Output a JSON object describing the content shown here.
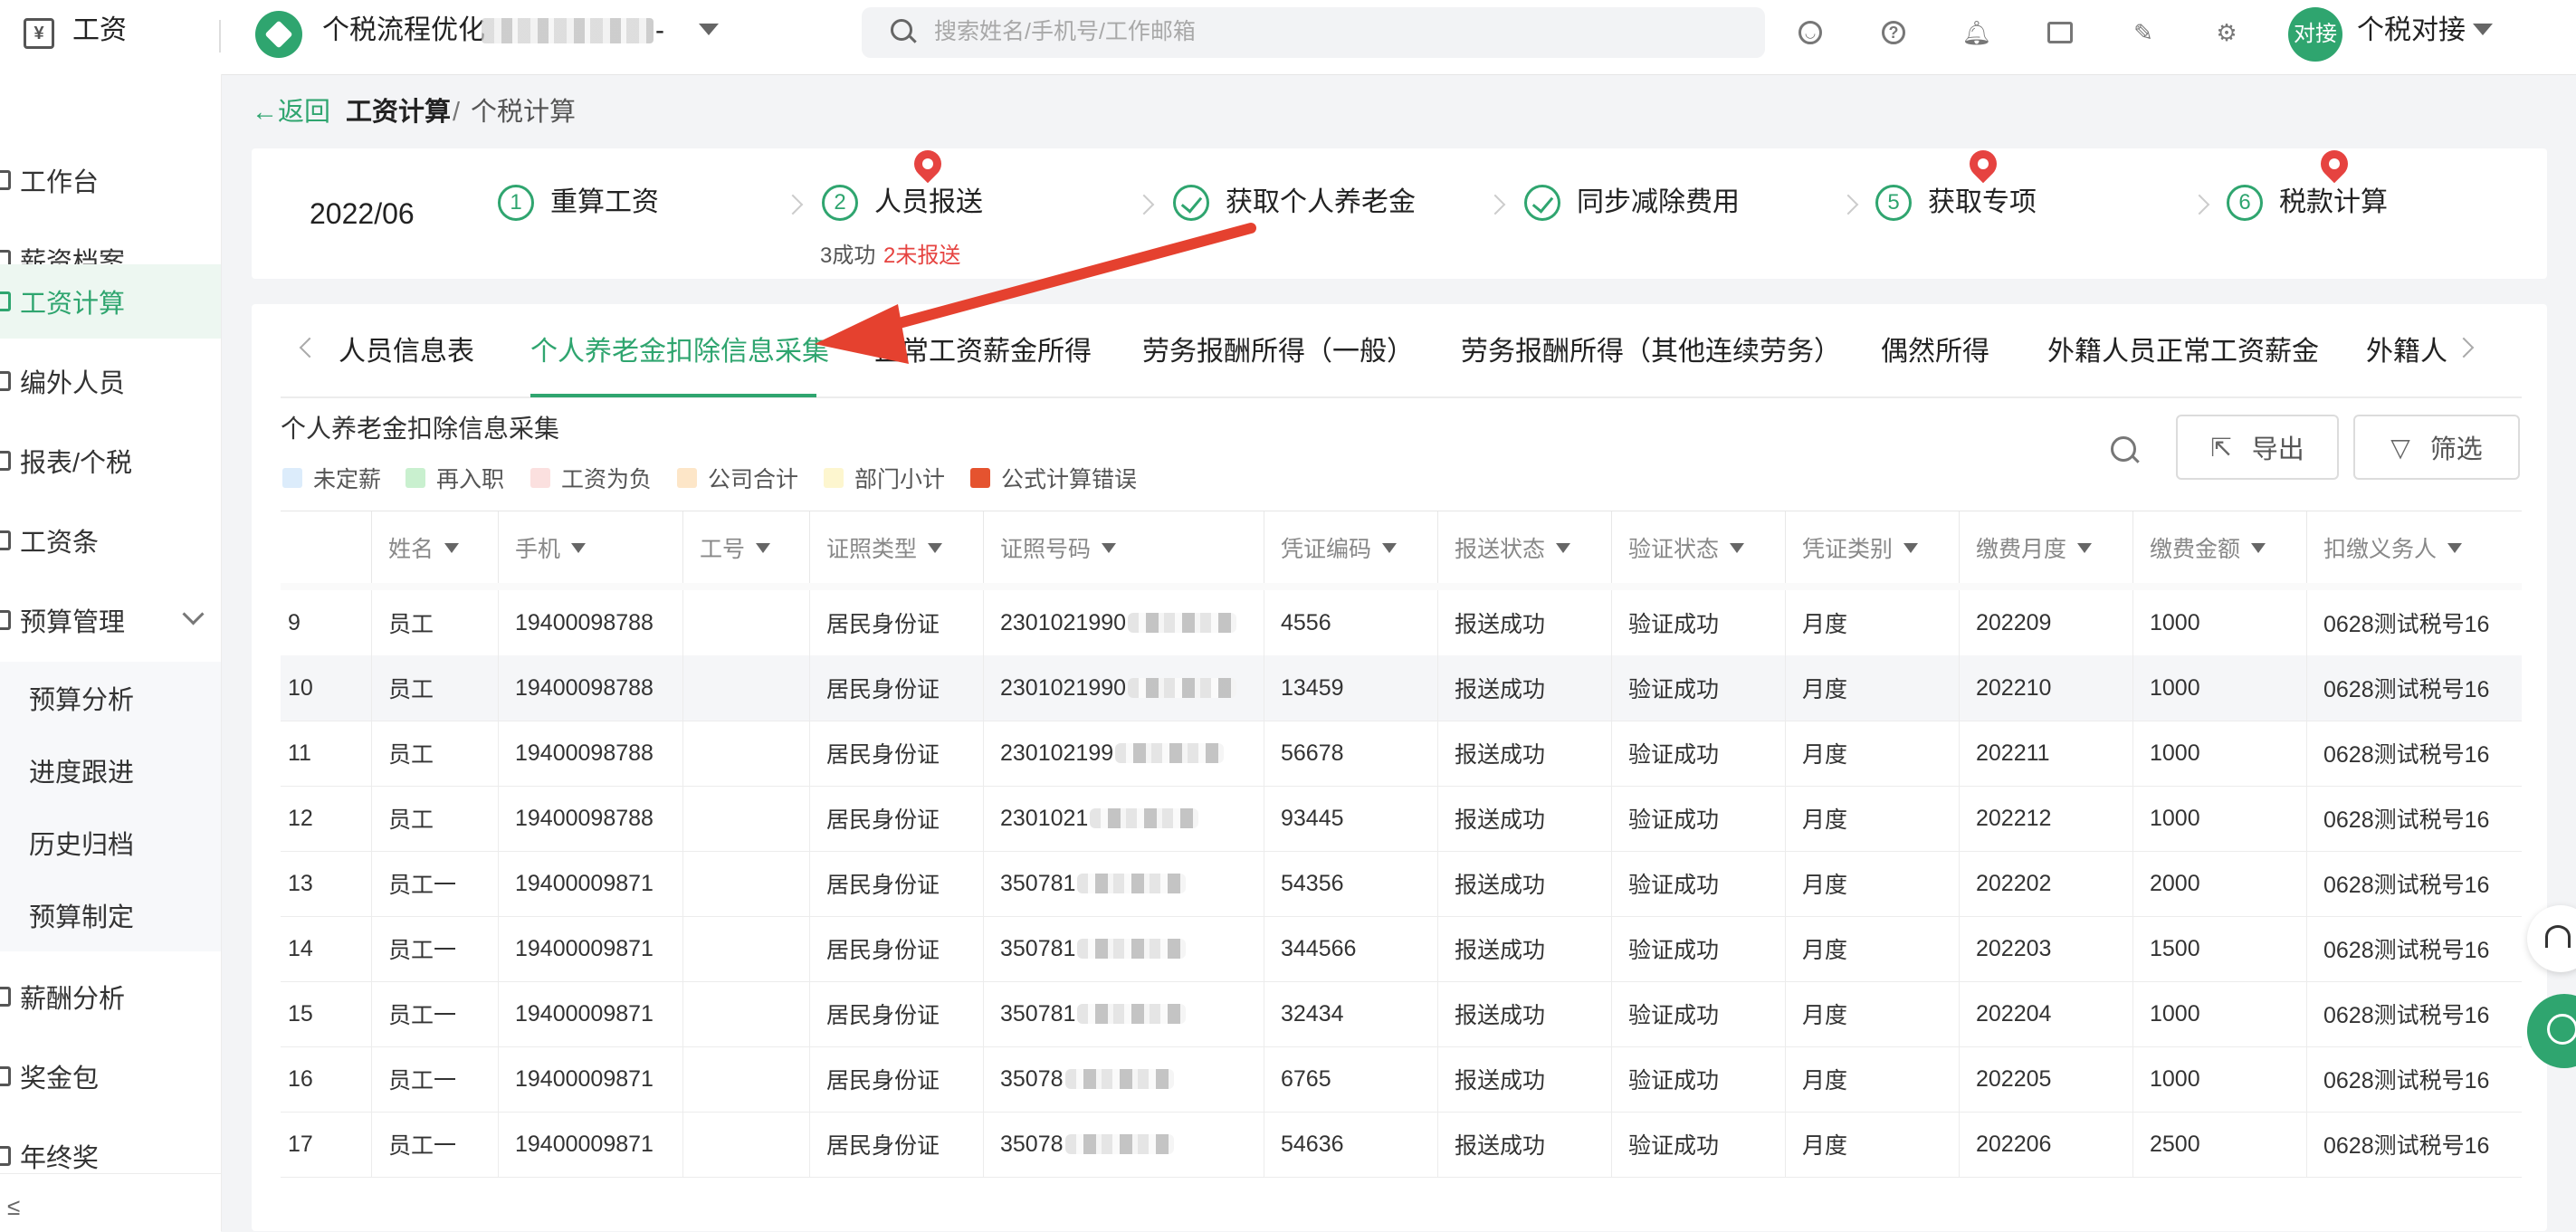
{
  "topbar": {
    "app_icon": "yen-icon",
    "app_name": "工资",
    "company": "个税流程优化",
    "company_suffix": "-",
    "search_placeholder": "搜索姓名/手机号/工作邮箱",
    "avatar_text": "对接",
    "user_name": "个税对接"
  },
  "sidebar": {
    "items": [
      {
        "label": "工作台"
      },
      {
        "label": "薪资档案"
      },
      {
        "label": "工资计算"
      },
      {
        "label": "编外人员"
      },
      {
        "label": "报表/个税"
      },
      {
        "label": "工资条"
      },
      {
        "label": "预算管理"
      },
      {
        "label": "薪酬分析"
      },
      {
        "label": "奖金包"
      },
      {
        "label": "年终奖"
      }
    ],
    "sub_items": [
      {
        "label": "预算分析"
      },
      {
        "label": "进度跟进"
      },
      {
        "label": "历史归档"
      },
      {
        "label": "预算制定"
      }
    ],
    "collapse_icon": "≤"
  },
  "breadcrumb": {
    "back": "←返回",
    "current": "工资计算",
    "separator": "/",
    "sub": "个税计算"
  },
  "steps": {
    "period": "2022/06",
    "items": [
      {
        "num": "1",
        "label": "重算工资"
      },
      {
        "num": "2",
        "label": "人员报送",
        "sub_ok": "3成功",
        "sub_bad": "2未报送"
      },
      {
        "num": "",
        "label": "获取个人养老金"
      },
      {
        "num": "",
        "label": "同步减除费用"
      },
      {
        "num": "5",
        "label": "获取专项"
      },
      {
        "num": "6",
        "label": "税款计算"
      }
    ]
  },
  "tabs": [
    "人员信息表",
    "个人养老金扣除信息采集",
    "正常工资薪金所得",
    "劳务报酬所得（一般）",
    "劳务报酬所得（其他连续劳务）",
    "偶然所得",
    "外籍人员正常工资薪金",
    "外籍人"
  ],
  "section": {
    "title": "个人养老金扣除信息采集",
    "export": "导出",
    "filter": "筛选"
  },
  "legend": [
    {
      "label": "未定薪",
      "color": "#dcecfb"
    },
    {
      "label": "再入职",
      "color": "#c9f0cf"
    },
    {
      "label": "工资为负",
      "color": "#fbe0df"
    },
    {
      "label": "公司合计",
      "color": "#fde6c8"
    },
    {
      "label": "部门小计",
      "color": "#fdf6cf"
    },
    {
      "label": "公式计算错误",
      "color": "#e5532f"
    }
  ],
  "table": {
    "columns": [
      "姓名",
      "手机",
      "工号",
      "证照类型",
      "证照号码",
      "凭证编码",
      "报送状态",
      "验证状态",
      "凭证类别",
      "缴费月度",
      "缴费金额",
      "扣缴义务人"
    ],
    "rows": [
      {
        "no": "9",
        "name": "员工",
        "phone": "19400098788",
        "id": "",
        "id_type": "居民身份证",
        "id_no": "2301021990",
        "code": "4556",
        "send": "报送成功",
        "verify": "验证成功",
        "category": "月度",
        "month": "202209",
        "amount": "1000",
        "agent": "0628测试税号16"
      },
      {
        "no": "10",
        "name": "员工",
        "phone": "19400098788",
        "id": "",
        "id_type": "居民身份证",
        "id_no": "2301021990",
        "code": "13459",
        "send": "报送成功",
        "verify": "验证成功",
        "category": "月度",
        "month": "202210",
        "amount": "1000",
        "agent": "0628测试税号16"
      },
      {
        "no": "11",
        "name": "员工",
        "phone": "19400098788",
        "id": "",
        "id_type": "居民身份证",
        "id_no": "230102199",
        "code": "56678",
        "send": "报送成功",
        "verify": "验证成功",
        "category": "月度",
        "month": "202211",
        "amount": "1000",
        "agent": "0628测试税号16"
      },
      {
        "no": "12",
        "name": "员工",
        "phone": "19400098788",
        "id": "",
        "id_type": "居民身份证",
        "id_no": "2301021",
        "code": "93445",
        "send": "报送成功",
        "verify": "验证成功",
        "category": "月度",
        "month": "202212",
        "amount": "1000",
        "agent": "0628测试税号16"
      },
      {
        "no": "13",
        "name": "员工一",
        "phone": "19400009871",
        "id": "",
        "id_type": "居民身份证",
        "id_no": "350781",
        "code": "54356",
        "send": "报送成功",
        "verify": "验证成功",
        "category": "月度",
        "month": "202202",
        "amount": "2000",
        "agent": "0628测试税号16"
      },
      {
        "no": "14",
        "name": "员工一",
        "phone": "19400009871",
        "id": "",
        "id_type": "居民身份证",
        "id_no": "350781",
        "code": "344566",
        "send": "报送成功",
        "verify": "验证成功",
        "category": "月度",
        "month": "202203",
        "amount": "1500",
        "agent": "0628测试税号16"
      },
      {
        "no": "15",
        "name": "员工一",
        "phone": "19400009871",
        "id": "",
        "id_type": "居民身份证",
        "id_no": "350781",
        "code": "32434",
        "send": "报送成功",
        "verify": "验证成功",
        "category": "月度",
        "month": "202204",
        "amount": "1000",
        "agent": "0628测试税号16"
      },
      {
        "no": "16",
        "name": "员工一",
        "phone": "19400009871",
        "id": "",
        "id_type": "居民身份证",
        "id_no": "35078",
        "code": "6765",
        "send": "报送成功",
        "verify": "验证成功",
        "category": "月度",
        "month": "202205",
        "amount": "1000",
        "agent": "0628测试税号16"
      },
      {
        "no": "17",
        "name": "员工一",
        "phone": "19400009871",
        "id": "",
        "id_type": "居民身份证",
        "id_no": "35078",
        "code": "54636",
        "send": "报送成功",
        "verify": "验证成功",
        "category": "月度",
        "month": "202206",
        "amount": "2500",
        "agent": "0628测试税号16"
      }
    ]
  },
  "colors": {
    "accent": "#2fa56f",
    "error": "#e64340",
    "annotation_arrow": "#e5412f"
  }
}
